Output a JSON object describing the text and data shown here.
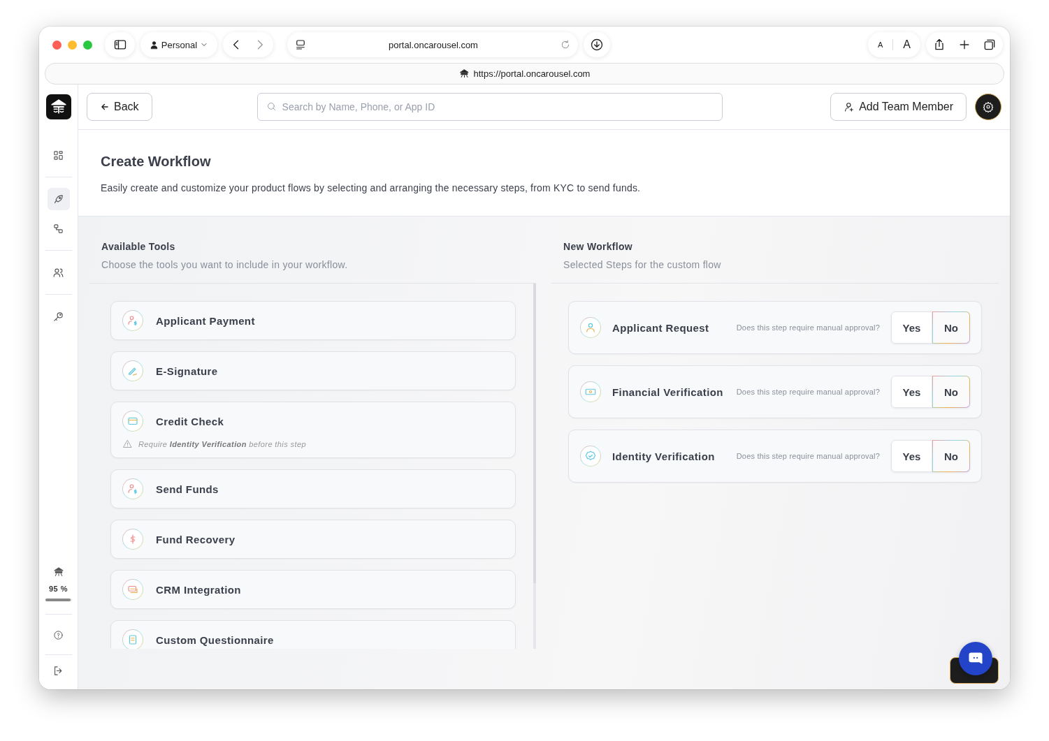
{
  "browser": {
    "profile": "Personal",
    "tab_url": "portal.oncarousel.com",
    "address": "https://portal.oncarousel.com",
    "text_size_small": "A",
    "text_size_large": "A"
  },
  "sidebar": {
    "items": [
      {
        "kind": "grid",
        "selected": false
      },
      {
        "kind": "rocket",
        "selected": true
      },
      {
        "kind": "flow",
        "selected": false
      },
      {
        "kind": "users",
        "selected": false
      },
      {
        "kind": "key",
        "selected": false
      }
    ],
    "usage": {
      "reading": "95 %",
      "level": 0.95
    }
  },
  "header": {
    "back": "Back",
    "search_placeholder": "Search by Name, Phone, or App ID",
    "add_member": "Add Team Member"
  },
  "page": {
    "title": "Create Workflow",
    "description": "Easily create and customize your product flows by selecting and arranging the necessary steps, from KYC to send funds."
  },
  "available_tools": {
    "title": "Available Tools",
    "subtitle": "Choose the tools you want to include in your workflow.",
    "items": [
      {
        "name": "Applicant Payment",
        "kind": "payment"
      },
      {
        "name": "E-Signature",
        "kind": "signature"
      },
      {
        "name": "Credit Check",
        "kind": "credit",
        "note": "Require **Identity Verification** before this step"
      },
      {
        "name": "Send Funds",
        "kind": "payment"
      },
      {
        "name": "Fund Recovery",
        "kind": "recovery"
      },
      {
        "name": "CRM Integration",
        "kind": "crm"
      },
      {
        "name": "Custom Questionnaire",
        "kind": "questionnaire"
      }
    ]
  },
  "new_workflow": {
    "title": "New Workflow",
    "subtitle": "Selected Steps for the custom flow",
    "steps": [
      {
        "name": "Applicant Request",
        "kind": "request",
        "question": "Does this step require manual approval?",
        "options": [
          {
            "label": "Yes",
            "selected": false
          },
          {
            "label": "No",
            "selected": true
          }
        ]
      },
      {
        "name": "Financial Verification",
        "kind": "financial",
        "question": "Does this step require manual approval?",
        "options": [
          {
            "label": "Yes",
            "selected": false
          },
          {
            "label": "No",
            "selected": true
          }
        ]
      },
      {
        "name": "Identity Verification",
        "kind": "identity",
        "question": "Does this step require manual approval?",
        "options": [
          {
            "label": "Yes",
            "selected": false
          },
          {
            "label": "No",
            "selected": true
          }
        ]
      }
    ]
  }
}
